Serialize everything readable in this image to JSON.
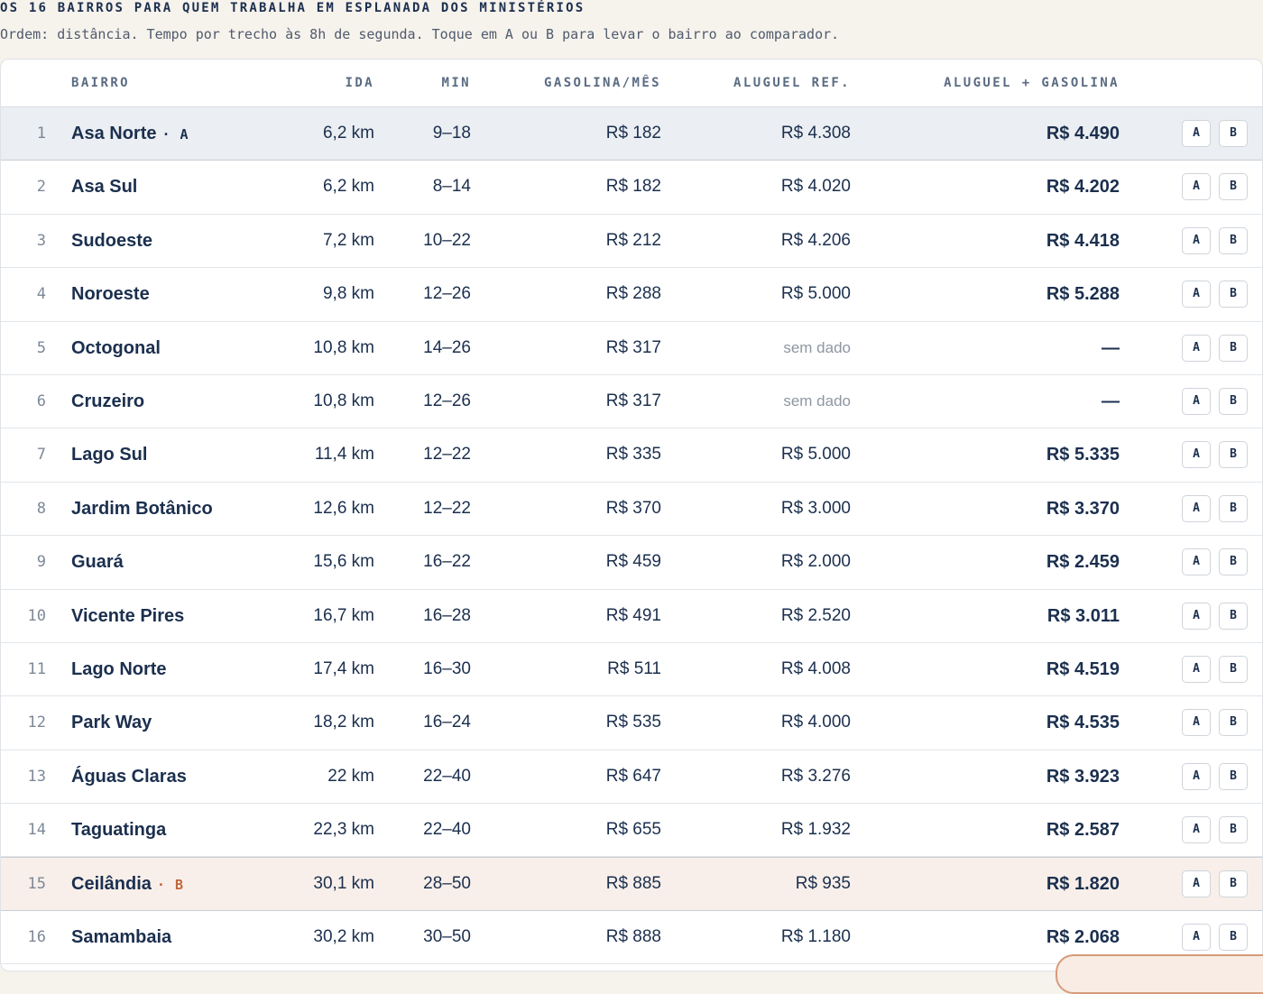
{
  "heading": "OS 16 BAIRROS PARA QUEM TRABALHA EM ESPLANADA DOS MINISTÉRIOS",
  "subtitle": "Ordem: distância. Tempo por trecho às 8h de segunda. Toque em A ou B para levar o bairro ao comparador.",
  "columns": {
    "bairro": "BAIRRO",
    "ida": "IDA",
    "min": "MIN",
    "gasolina": "GASOLINA/MÊS",
    "aluguel": "ALUGUEL REF.",
    "total": "ALUGUEL + GASOLINA"
  },
  "buttons": {
    "a": "A",
    "b": "B"
  },
  "tag_prefix": "·",
  "rows": [
    {
      "rank": "1",
      "name": "Asa Norte",
      "tag": "A",
      "ida": "6,2 km",
      "min": "9–18",
      "gas": "R$ 182",
      "aluguel": "R$ 4.308",
      "total": "R$ 4.490"
    },
    {
      "rank": "2",
      "name": "Asa Sul",
      "tag": "",
      "ida": "6,2 km",
      "min": "8–14",
      "gas": "R$ 182",
      "aluguel": "R$ 4.020",
      "total": "R$ 4.202"
    },
    {
      "rank": "3",
      "name": "Sudoeste",
      "tag": "",
      "ida": "7,2 km",
      "min": "10–22",
      "gas": "R$ 212",
      "aluguel": "R$ 4.206",
      "total": "R$ 4.418"
    },
    {
      "rank": "4",
      "name": "Noroeste",
      "tag": "",
      "ida": "9,8 km",
      "min": "12–26",
      "gas": "R$ 288",
      "aluguel": "R$ 5.000",
      "total": "R$ 5.288"
    },
    {
      "rank": "5",
      "name": "Octogonal",
      "tag": "",
      "ida": "10,8 km",
      "min": "14–26",
      "gas": "R$ 317",
      "aluguel": "sem dado",
      "total": "—"
    },
    {
      "rank": "6",
      "name": "Cruzeiro",
      "tag": "",
      "ida": "10,8 km",
      "min": "12–26",
      "gas": "R$ 317",
      "aluguel": "sem dado",
      "total": "—"
    },
    {
      "rank": "7",
      "name": "Lago Sul",
      "tag": "",
      "ida": "11,4 km",
      "min": "12–22",
      "gas": "R$ 335",
      "aluguel": "R$ 5.000",
      "total": "R$ 5.335"
    },
    {
      "rank": "8",
      "name": "Jardim Botânico",
      "tag": "",
      "ida": "12,6 km",
      "min": "12–22",
      "gas": "R$ 370",
      "aluguel": "R$ 3.000",
      "total": "R$ 3.370"
    },
    {
      "rank": "9",
      "name": "Guará",
      "tag": "",
      "ida": "15,6 km",
      "min": "16–22",
      "gas": "R$ 459",
      "aluguel": "R$ 2.000",
      "total": "R$ 2.459"
    },
    {
      "rank": "10",
      "name": "Vicente Pires",
      "tag": "",
      "ida": "16,7 km",
      "min": "16–28",
      "gas": "R$ 491",
      "aluguel": "R$ 2.520",
      "total": "R$ 3.011"
    },
    {
      "rank": "11",
      "name": "Lago Norte",
      "tag": "",
      "ida": "17,4 km",
      "min": "16–30",
      "gas": "R$ 511",
      "aluguel": "R$ 4.008",
      "total": "R$ 4.519"
    },
    {
      "rank": "12",
      "name": "Park Way",
      "tag": "",
      "ida": "18,2 km",
      "min": "16–24",
      "gas": "R$ 535",
      "aluguel": "R$ 4.000",
      "total": "R$ 4.535"
    },
    {
      "rank": "13",
      "name": "Águas Claras",
      "tag": "",
      "ida": "22 km",
      "min": "22–40",
      "gas": "R$ 647",
      "aluguel": "R$ 3.276",
      "total": "R$ 3.923"
    },
    {
      "rank": "14",
      "name": "Taguatinga",
      "tag": "",
      "ida": "22,3 km",
      "min": "22–40",
      "gas": "R$ 655",
      "aluguel": "R$ 1.932",
      "total": "R$ 2.587"
    },
    {
      "rank": "15",
      "name": "Ceilândia",
      "tag": "B",
      "ida": "30,1 km",
      "min": "28–50",
      "gas": "R$ 885",
      "aluguel": "R$ 935",
      "total": "R$ 1.820"
    },
    {
      "rank": "16",
      "name": "Samambaia",
      "tag": "",
      "ida": "30,2 km",
      "min": "30–50",
      "gas": "R$ 888",
      "aluguel": "R$ 1.180",
      "total": "R$ 2.068"
    }
  ],
  "colors": {
    "selected_a_bg": "#ebeef2",
    "selected_b_bg": "#f8efea",
    "tag_b": "#c0673a",
    "text": "#1b2f4e"
  }
}
